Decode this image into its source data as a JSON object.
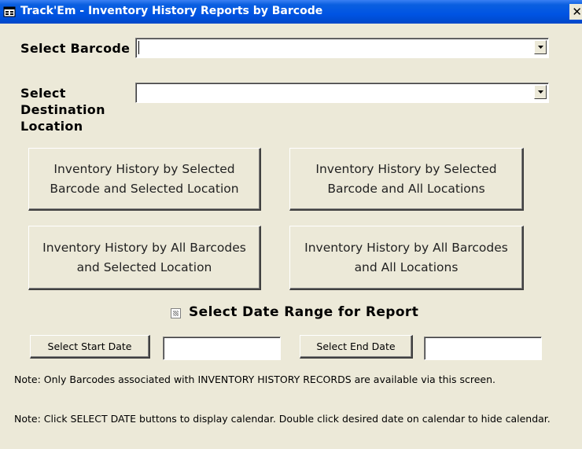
{
  "window": {
    "title": "Track'Em - Inventory History Reports by Barcode",
    "close_glyph": "✕"
  },
  "barcode": {
    "label": "Select Barcode",
    "value": ""
  },
  "location": {
    "label": "Select Destination Location",
    "value": ""
  },
  "buttons": {
    "sel_barcode_sel_loc": "Inventory History by Selected Barcode and Selected Location",
    "sel_barcode_all_loc": "Inventory History by Selected Barcode and All Locations",
    "all_barcode_sel_loc": "Inventory History by All Barcodes and Selected Location",
    "all_barcode_all_loc": "Inventory History by All Barcodes and All Locations"
  },
  "date_range": {
    "checkbox_label": "Select Date Range for Report",
    "checked_state": "indeterminate",
    "start_button": "Select Start Date",
    "start_value": "",
    "end_button": "Select End Date",
    "end_value": ""
  },
  "notes": {
    "note1": "Note: Only Barcodes associated with INVENTORY HISTORY RECORDS are available via this screen.",
    "note2": "Note: Click SELECT DATE buttons to display calendar.  Double click desired date on calendar to hide calendar."
  },
  "icons": {
    "form_icon": "access-form-icon",
    "dropdown": "chevron-down-icon"
  },
  "colors": {
    "titlebar": "#0054e3",
    "window_bg": "#ece9d8"
  }
}
